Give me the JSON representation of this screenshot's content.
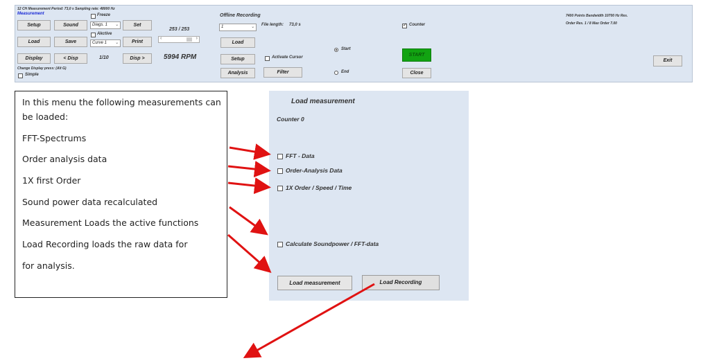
{
  "toolbar": {
    "info_line": "12 CH Measurement Period: 73,0 s Sampling rate: 48000 Hz",
    "measurement_label": "Measurement",
    "setup": "Setup",
    "sound": "Sound",
    "load": "Load",
    "save": "Save",
    "display": "Display",
    "prev_disp": "< Disp",
    "next_disp": "Disp >",
    "page_indicator": "1/10",
    "freeze_label": "Freeze",
    "akctive_label": "Akctive",
    "diags_select": "Diags. 1",
    "curve_select": "Curve 1",
    "set": "Set",
    "print": "Print",
    "counter_display": "253 / 253",
    "rpm": "5994 RPM",
    "change_display_hint": "Change Display press: (Alt G)",
    "simple_label": "Simple",
    "offline_recording_label": "Offline Recording",
    "channel_select": "1",
    "file_length_label": "File length:",
    "file_length_value": "73,0 s",
    "load_btn": "Load",
    "setup_btn": "Setup",
    "analysis_btn": "Analysis",
    "activate_cursor_label": "Activate Cursor",
    "filter_btn": "Filter",
    "start_radio": "Start",
    "end_radio": "End",
    "counter_label": "Counter",
    "start_btn": "START",
    "close_btn": "Close",
    "points_info": "7400 Points Bandwidth 10700 Hz Res.",
    "order_info": "Order Res. 1 / 8 Max Order 7.00",
    "exit_btn": "Exit"
  },
  "explanation": {
    "lines": [
      "In this menu the following measurements can",
      "be loaded:",
      "FFT-Spectrums",
      "Order analysis data",
      "1X first Order",
      "Sound power data recalculated",
      "Measurement Loads the active functions",
      "Load Recording loads the raw data for",
      "for analysis."
    ]
  },
  "panel": {
    "title": "Load measurement",
    "counter": "Counter 0",
    "fft_data": "FFT - Data",
    "order_analysis": "Order-Analysis Data",
    "first_order": "1X Order /  Speed / Time",
    "soundpower": "Calculate Soundpower / FFT-data",
    "load_measurement_btn": "Load measurement",
    "load_recording_btn": "Load Recording"
  },
  "colors": {
    "toolbar_bg": "#dde6f2",
    "accent_blue": "#1a2bd6",
    "start_green": "#12a312",
    "arrow_red": "#e01212"
  }
}
